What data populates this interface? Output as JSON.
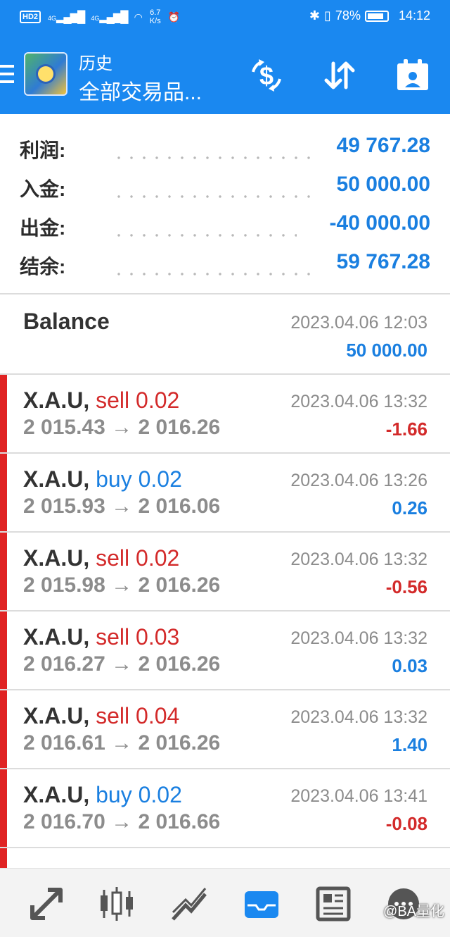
{
  "status_bar": {
    "hd": "HD",
    "sim": "2",
    "sig1": "4G",
    "sig2": "4G",
    "speed_value": "6.7",
    "speed_unit": "K/s",
    "battery": "78%",
    "time": "14:12"
  },
  "app_bar": {
    "title": "历史",
    "subtitle": "全部交易品..."
  },
  "summary": {
    "rows": [
      {
        "label": "利润:",
        "value": "49 767.28"
      },
      {
        "label": "入金:",
        "value": "50 000.00"
      },
      {
        "label": "出金:",
        "value": "-40 000.00"
      },
      {
        "label": "结余:",
        "value": "59 767.28"
      }
    ]
  },
  "balance": {
    "title": "Balance",
    "time": "2023.04.06 12:03",
    "amount": "50 000.00"
  },
  "trades": [
    {
      "symbol": "X.A.U",
      "side": "sell 0.02",
      "prices": "2 015.43 → 2 016.26",
      "time": "2023.04.06 13:32",
      "profit": "-1.66"
    },
    {
      "symbol": "X.A.U",
      "side": "buy 0.02",
      "prices": "2 015.93 → 2 016.06",
      "time": "2023.04.06 13:26",
      "profit": "0.26"
    },
    {
      "symbol": "X.A.U",
      "side": "sell 0.02",
      "prices": "2 015.98 → 2 016.26",
      "time": "2023.04.06 13:32",
      "profit": "-0.56"
    },
    {
      "symbol": "X.A.U",
      "side": "sell 0.03",
      "prices": "2 016.27 → 2 016.26",
      "time": "2023.04.06 13:32",
      "profit": "0.03"
    },
    {
      "symbol": "X.A.U",
      "side": "sell 0.04",
      "prices": "2 016.61 → 2 016.26",
      "time": "2023.04.06 13:32",
      "profit": "1.40"
    },
    {
      "symbol": "X.A.U",
      "side": "buy 0.02",
      "prices": "2 016.70 → 2 016.66",
      "time": "2023.04.06 13:41",
      "profit": "-0.08"
    }
  ],
  "separator": ",",
  "watermark": "@BA量化",
  "icons": {
    "menu": "hamburger-menu-icon",
    "dollar_sync": "dollar-refresh-icon",
    "sort": "sort-arrows-icon",
    "calendar": "calendar-person-icon",
    "nav": [
      "quotes-arrows-icon",
      "candlestick-chart-icon",
      "trend-line-icon",
      "inbox-tray-icon",
      "news-icon",
      "chat-bubble-icon"
    ]
  },
  "colors": {
    "brand_blue": "#1a88f0",
    "value_blue": "#1a7fe0",
    "loss_red": "#d32a2a",
    "accent_bar": "#e02323",
    "active_nav": "#1a88f0"
  }
}
